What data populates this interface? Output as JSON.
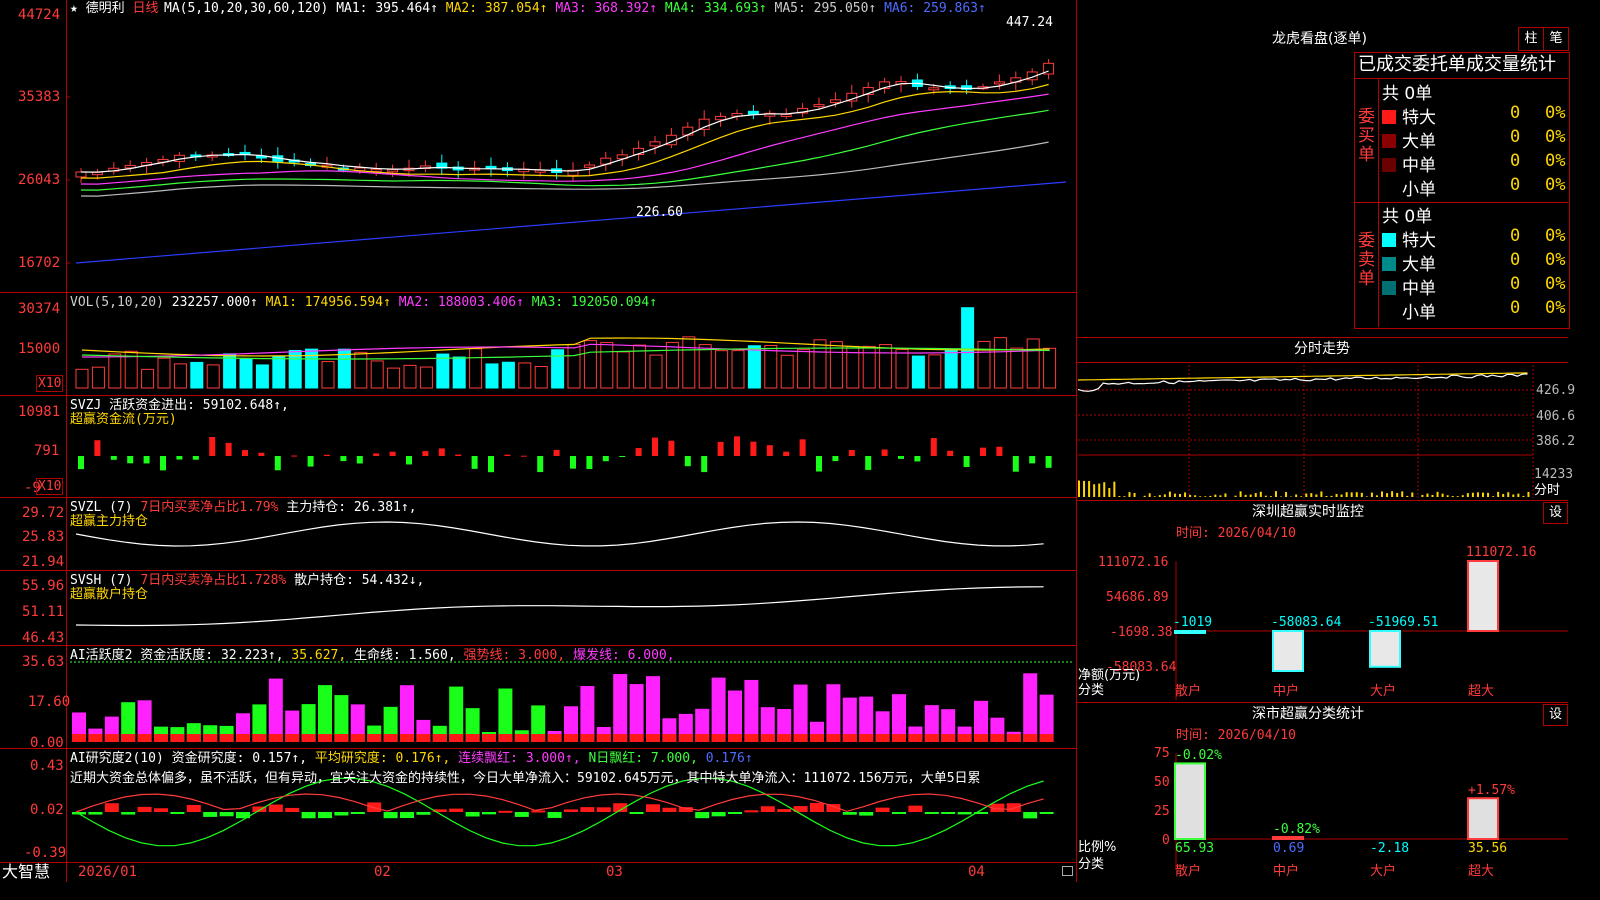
{
  "stock": {
    "name": "德明利",
    "period": "日线"
  },
  "price_axis": [
    "44724",
    "35383",
    "26043",
    "16702"
  ],
  "price_header": [
    {
      "text": "MA(5,10,20,30,60,120)",
      "color": "#ffffff"
    },
    {
      "text": "MA1: 395.464↑",
      "color": "#ffffff"
    },
    {
      "text": "MA2: 387.054↑",
      "color": "#ffd700"
    },
    {
      "text": "MA3: 368.392↑",
      "color": "#ff3cff"
    },
    {
      "text": "MA4: 334.693↑",
      "color": "#3cff3c"
    },
    {
      "text": "MA5: 295.050↑",
      "color": "#cccccc"
    },
    {
      "text": "MA6: 259.863↑",
      "color": "#4e6bff"
    }
  ],
  "price_marks": {
    "high": "447.24",
    "low": "226.60"
  },
  "vol_axis": [
    "30374",
    "15000"
  ],
  "vol_unit": "X10",
  "vol_header": [
    {
      "text": "VOL(5,10,20)",
      "color": "#cccccc"
    },
    {
      "text": "232257.000↑",
      "color": "#ffffff"
    },
    {
      "text": "MA1: 174956.594↑",
      "color": "#ffd700"
    },
    {
      "text": "MA2: 188003.406↑",
      "color": "#ff3cff"
    },
    {
      "text": "MA3: 192050.094↑",
      "color": "#3cff3c"
    }
  ],
  "svzj": {
    "axis": [
      "10981",
      "791",
      "-9"
    ],
    "unit": "X10",
    "l1": "SVZJ  活跃资金进出: 59102.648↑,",
    "l2": "超赢资金流(万元)"
  },
  "svzl": {
    "axis": [
      "29.72",
      "25.83",
      "21.94"
    ],
    "a": "SVZL (7)",
    "b": "7日内买卖净占比1.79%",
    "c": "主力持仓: 26.381↑,",
    "l2": "超赢主力持仓"
  },
  "svsh": {
    "axis": [
      "55.96",
      "51.11",
      "46.43"
    ],
    "a": "SVSH (7)",
    "b": "7日内买卖净占比1.728%",
    "c": "散户持仓: 54.432↓,",
    "l2": "超赢散户持仓"
  },
  "ai1": {
    "axis": [
      "35.63",
      "17.60",
      "0.00"
    ],
    "parts": [
      {
        "text": "AI活跃度2 资金活跃度: 32.223↑,",
        "color": "#ffffff"
      },
      {
        "text": "35.627,",
        "color": "#ffd700"
      },
      {
        "text": "生命线: 1.560,",
        "color": "#ffffff"
      },
      {
        "text": "强势线: 3.000,",
        "color": "#ff3b3b"
      },
      {
        "text": "爆发线: 6.000,",
        "color": "#ff3cff"
      }
    ]
  },
  "ai2": {
    "axis": [
      "0.43",
      "0.02",
      "-0.39"
    ],
    "parts": [
      {
        "text": "AI研究度2(10) 资金研究度: 0.157↑,",
        "color": "#ffffff"
      },
      {
        "text": "平均研究度: 0.176↑,",
        "color": "#ffd700"
      },
      {
        "text": "连续飘红: 3.000↑,",
        "color": "#ff3cff"
      },
      {
        "text": "N日飘红: 7.000,",
        "color": "#3cff3c"
      },
      {
        "text": "0.176↑",
        "color": "#4e6bff"
      }
    ],
    "comment": "近期大资金总体偏多，虽不活跃，但有异动，宜关注大资金的持续性，今日大单净流入：59102.645万元，其中特大单净流入：111072.156万元，大单5日累"
  },
  "xaxis": {
    "brand": "大智慧",
    "labels": [
      "2026/01",
      "02",
      "03",
      "04"
    ]
  },
  "lhb": {
    "title": "龙虎看盘(逐单)",
    "btn1": "柱",
    "btn2": "笔",
    "subtitle": "已成交委托单成交量统计",
    "buy_label": "委买单",
    "sell_label": "委卖单",
    "buy_total": "共 0单",
    "sell_total": "共 0单",
    "buy_rows": [
      {
        "name": "特大",
        "v": "0",
        "p": "0%",
        "color": "#ff1a1a"
      },
      {
        "name": "大单",
        "v": "0",
        "p": "0%",
        "color": "#8b0000"
      },
      {
        "name": "中单",
        "v": "0",
        "p": "0%",
        "color": "#6b0000"
      },
      {
        "name": "小单",
        "v": "0",
        "p": "0%",
        "color": ""
      }
    ],
    "sell_rows": [
      {
        "name": "特大",
        "v": "0",
        "p": "0%",
        "color": "#00ffff"
      },
      {
        "name": "大单",
        "v": "0",
        "p": "0%",
        "color": "#008b8b"
      },
      {
        "name": "中单",
        "v": "0",
        "p": "0%",
        "color": "#007070"
      },
      {
        "name": "小单",
        "v": "0",
        "p": "0%",
        "color": ""
      }
    ]
  },
  "intraday": {
    "title": "分时走势",
    "axis": [
      "426.9",
      "406.6",
      "386.2",
      "14233"
    ],
    "unit": "分时"
  },
  "sz_monitor": {
    "title": "深圳超赢实时监控",
    "btn": "设",
    "date": "时间: 2026/04/10",
    "axis": [
      "111072.16",
      "54686.89",
      "-1698.38",
      "-58083.64"
    ],
    "ylabel1": "净额(万元)",
    "ylabel2": "分类",
    "bars": [
      {
        "label": "散户",
        "value": -1019,
        "text": "-1019"
      },
      {
        "label": "中户",
        "value": -58083.64,
        "text": "-58083.64"
      },
      {
        "label": "大户",
        "value": -51969.51,
        "text": "-51969.51"
      },
      {
        "label": "超大",
        "value": 111072.16,
        "text": "111072.16"
      }
    ]
  },
  "sz_class": {
    "title": "深市超赢分类统计",
    "btn": "设",
    "date": "时间: 2026/04/10",
    "axis": [
      "75",
      "50",
      "25",
      "0"
    ],
    "ylabel1": "比例%",
    "ylabel2": "分类",
    "bars": [
      {
        "label": "散户",
        "value": 65.93,
        "text": "65.93",
        "chg": "-0.02%"
      },
      {
        "label": "中户",
        "value": 0.69,
        "text": "0.69",
        "chg": "-0.82%"
      },
      {
        "label": "大户",
        "value": -2.18,
        "text": "-2.18",
        "chg": ""
      },
      {
        "label": "超大",
        "value": 35.56,
        "text": "35.56",
        "chg": "+1.57%"
      }
    ]
  }
}
